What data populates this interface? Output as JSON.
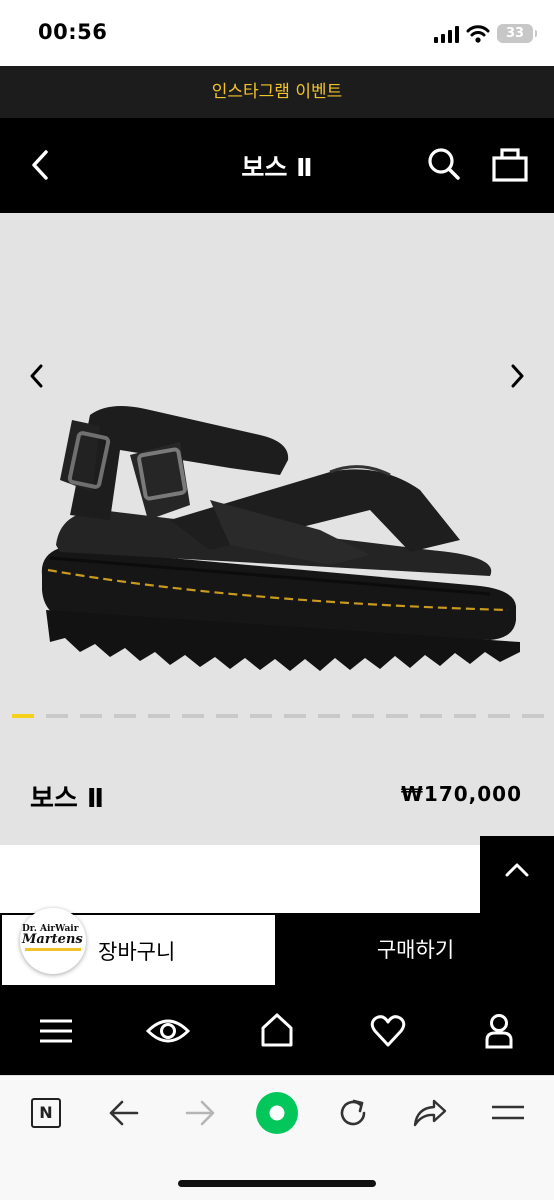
{
  "status_bar": {
    "time": "00:56",
    "battery": "33"
  },
  "event_banner": {
    "text": "인스타그램 이벤트"
  },
  "header": {
    "title": "보스 Ⅱ"
  },
  "product": {
    "name": "보스 Ⅱ",
    "price": "₩170,000",
    "gallery_total": 16,
    "gallery_current": 1
  },
  "actions": {
    "cart_label": "장바구니",
    "buy_label": "구매하기",
    "logo_line1": "Dr. AirWair",
    "logo_line2": "Martens"
  },
  "browser": {
    "n_label": "N"
  },
  "colors": {
    "accent_yellow": "#f6d11a",
    "event_text": "#f2c22a",
    "brand_green": "#03c75a"
  }
}
